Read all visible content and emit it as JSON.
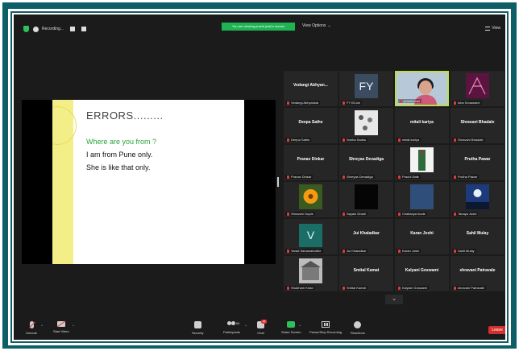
{
  "topbar": {
    "recording_label": "Recording...",
    "viewing_banner": "You are viewing prachi joshi's screen",
    "view_options": "View Options",
    "view_mode": "View"
  },
  "slide": {
    "title": "ERRORS.........",
    "question": "Where are you from ?",
    "line1": "I am from Pune only.",
    "line2": "She is like that only."
  },
  "tiles": [
    {
      "center": "Vedangi  Abhyan...",
      "foot": "Vedangi Abhyankar"
    },
    {
      "center": "FY",
      "foot": "FY BCom"
    },
    {
      "center": "",
      "foot": "prachi joshi"
    },
    {
      "center": "",
      "foot": "Isha Sonawane"
    },
    {
      "center": "Deepa Sathe",
      "foot": "Deepa Sathe"
    },
    {
      "center": "",
      "foot": "Sneha Sadhu"
    },
    {
      "center": "mitali kariya",
      "foot": "mitali kariya"
    },
    {
      "center": "Shravani Bhadale",
      "foot": "Shravani Bhadale"
    },
    {
      "center": "Pranav Dinkar",
      "foot": "Pranav Dinkar"
    },
    {
      "center": "Shreyas Devadiga",
      "foot": "Shreyas Devadiga"
    },
    {
      "center": "",
      "foot": "Prachi Date"
    },
    {
      "center": "Prutha Pawar",
      "foot": "Prutha Pawar"
    },
    {
      "center": "",
      "foot": "Shravani Gupte"
    },
    {
      "center": "",
      "foot": "Sayani Dhadi"
    },
    {
      "center": "",
      "foot": "Chaitanya Ikode"
    },
    {
      "center": "",
      "foot": "Tanaya Joshi"
    },
    {
      "center": "V",
      "foot": "Varad Sahasrabudhe"
    },
    {
      "center": "Jui Khaladkar",
      "foot": "Jui Khaladkar"
    },
    {
      "center": "Karan Joshi",
      "foot": "Karan Joshi"
    },
    {
      "center": "Sahil Mulay",
      "foot": "Sahil Mulay"
    },
    {
      "center": "",
      "foot": "Shubham Kirad"
    },
    {
      "center": "Smital Kamat",
      "foot": "Smital Kamat"
    },
    {
      "center": "Kalyani Goswami",
      "foot": "Kalyani Goswami"
    },
    {
      "center": "shravani Patravale",
      "foot": "shravani Patravale"
    }
  ],
  "toolbar": {
    "unmute": "Unmute",
    "start_video": "Start Video",
    "security": "Security",
    "participants": "Participants",
    "participant_count": "64",
    "chat": "Chat",
    "chat_badge": "34",
    "share_screen": "Share Screen",
    "recording": "Pause/Stop Recording",
    "reactions": "Reactions",
    "leave": "Leave"
  },
  "colors": {
    "frame": "#0d5e66",
    "banner": "#1fb354",
    "leave": "#d32f2f",
    "active_speaker": "#b9e04a"
  }
}
